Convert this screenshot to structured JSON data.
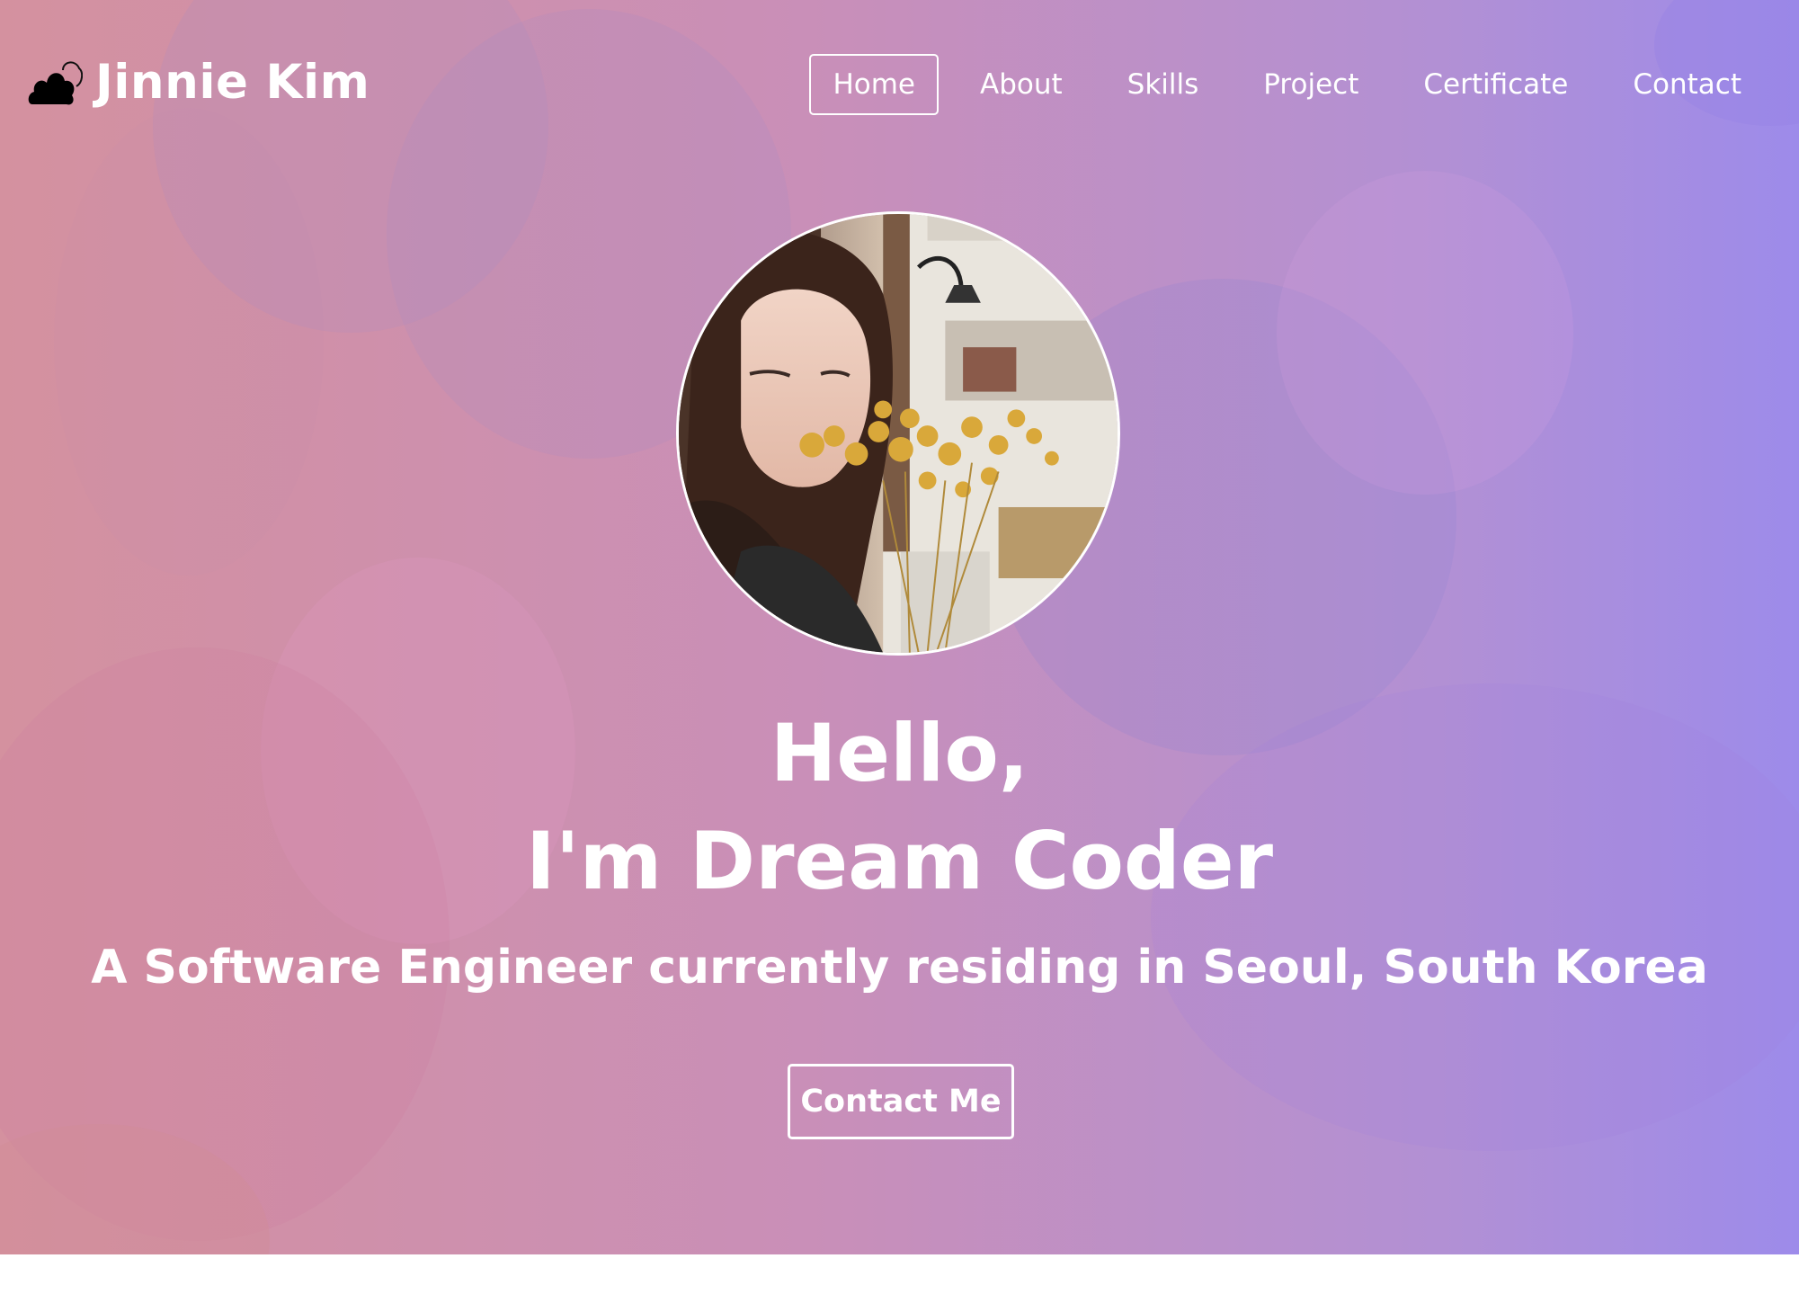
{
  "brand": {
    "name": "Jinnie Kim",
    "icon": "cloud-icon"
  },
  "nav": {
    "items": [
      {
        "label": "Home",
        "active": true
      },
      {
        "label": "About",
        "active": false
      },
      {
        "label": "Skills",
        "active": false
      },
      {
        "label": "Project",
        "active": false
      },
      {
        "label": "Certificate",
        "active": false
      },
      {
        "label": "Contact",
        "active": false
      }
    ]
  },
  "hero": {
    "greeting": "Hello,",
    "headline": "I'm Dream Coder",
    "description": "A Software Engineer currently residing in Seoul, South Korea",
    "cta_label": "Contact Me",
    "avatar_alt": "profile-photo"
  },
  "colors": {
    "gradient_start": "#d4919f",
    "gradient_mid": "#c98fb8",
    "gradient_end": "#9d8bea",
    "text": "#ffffff"
  }
}
